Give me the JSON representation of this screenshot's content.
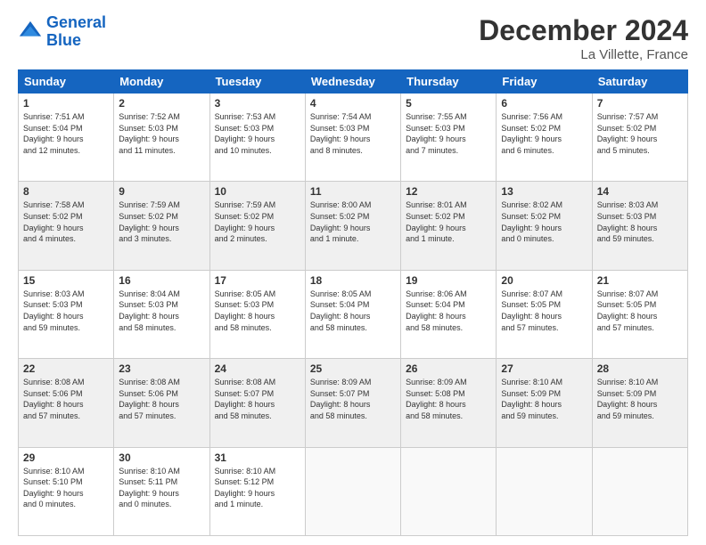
{
  "logo": {
    "line1": "General",
    "line2": "Blue"
  },
  "title": "December 2024",
  "location": "La Villette, France",
  "days_of_week": [
    "Sunday",
    "Monday",
    "Tuesday",
    "Wednesday",
    "Thursday",
    "Friday",
    "Saturday"
  ],
  "weeks": [
    [
      {
        "day": "1",
        "info": "Sunrise: 7:51 AM\nSunset: 5:04 PM\nDaylight: 9 hours\nand 12 minutes."
      },
      {
        "day": "2",
        "info": "Sunrise: 7:52 AM\nSunset: 5:03 PM\nDaylight: 9 hours\nand 11 minutes."
      },
      {
        "day": "3",
        "info": "Sunrise: 7:53 AM\nSunset: 5:03 PM\nDaylight: 9 hours\nand 10 minutes."
      },
      {
        "day": "4",
        "info": "Sunrise: 7:54 AM\nSunset: 5:03 PM\nDaylight: 9 hours\nand 8 minutes."
      },
      {
        "day": "5",
        "info": "Sunrise: 7:55 AM\nSunset: 5:03 PM\nDaylight: 9 hours\nand 7 minutes."
      },
      {
        "day": "6",
        "info": "Sunrise: 7:56 AM\nSunset: 5:02 PM\nDaylight: 9 hours\nand 6 minutes."
      },
      {
        "day": "7",
        "info": "Sunrise: 7:57 AM\nSunset: 5:02 PM\nDaylight: 9 hours\nand 5 minutes."
      }
    ],
    [
      {
        "day": "8",
        "info": "Sunrise: 7:58 AM\nSunset: 5:02 PM\nDaylight: 9 hours\nand 4 minutes."
      },
      {
        "day": "9",
        "info": "Sunrise: 7:59 AM\nSunset: 5:02 PM\nDaylight: 9 hours\nand 3 minutes."
      },
      {
        "day": "10",
        "info": "Sunrise: 7:59 AM\nSunset: 5:02 PM\nDaylight: 9 hours\nand 2 minutes."
      },
      {
        "day": "11",
        "info": "Sunrise: 8:00 AM\nSunset: 5:02 PM\nDaylight: 9 hours\nand 1 minute."
      },
      {
        "day": "12",
        "info": "Sunrise: 8:01 AM\nSunset: 5:02 PM\nDaylight: 9 hours\nand 1 minute."
      },
      {
        "day": "13",
        "info": "Sunrise: 8:02 AM\nSunset: 5:02 PM\nDaylight: 9 hours\nand 0 minutes."
      },
      {
        "day": "14",
        "info": "Sunrise: 8:03 AM\nSunset: 5:03 PM\nDaylight: 8 hours\nand 59 minutes."
      }
    ],
    [
      {
        "day": "15",
        "info": "Sunrise: 8:03 AM\nSunset: 5:03 PM\nDaylight: 8 hours\nand 59 minutes."
      },
      {
        "day": "16",
        "info": "Sunrise: 8:04 AM\nSunset: 5:03 PM\nDaylight: 8 hours\nand 58 minutes."
      },
      {
        "day": "17",
        "info": "Sunrise: 8:05 AM\nSunset: 5:03 PM\nDaylight: 8 hours\nand 58 minutes."
      },
      {
        "day": "18",
        "info": "Sunrise: 8:05 AM\nSunset: 5:04 PM\nDaylight: 8 hours\nand 58 minutes."
      },
      {
        "day": "19",
        "info": "Sunrise: 8:06 AM\nSunset: 5:04 PM\nDaylight: 8 hours\nand 58 minutes."
      },
      {
        "day": "20",
        "info": "Sunrise: 8:07 AM\nSunset: 5:05 PM\nDaylight: 8 hours\nand 57 minutes."
      },
      {
        "day": "21",
        "info": "Sunrise: 8:07 AM\nSunset: 5:05 PM\nDaylight: 8 hours\nand 57 minutes."
      }
    ],
    [
      {
        "day": "22",
        "info": "Sunrise: 8:08 AM\nSunset: 5:06 PM\nDaylight: 8 hours\nand 57 minutes."
      },
      {
        "day": "23",
        "info": "Sunrise: 8:08 AM\nSunset: 5:06 PM\nDaylight: 8 hours\nand 57 minutes."
      },
      {
        "day": "24",
        "info": "Sunrise: 8:08 AM\nSunset: 5:07 PM\nDaylight: 8 hours\nand 58 minutes."
      },
      {
        "day": "25",
        "info": "Sunrise: 8:09 AM\nSunset: 5:07 PM\nDaylight: 8 hours\nand 58 minutes."
      },
      {
        "day": "26",
        "info": "Sunrise: 8:09 AM\nSunset: 5:08 PM\nDaylight: 8 hours\nand 58 minutes."
      },
      {
        "day": "27",
        "info": "Sunrise: 8:10 AM\nSunset: 5:09 PM\nDaylight: 8 hours\nand 59 minutes."
      },
      {
        "day": "28",
        "info": "Sunrise: 8:10 AM\nSunset: 5:09 PM\nDaylight: 8 hours\nand 59 minutes."
      }
    ],
    [
      {
        "day": "29",
        "info": "Sunrise: 8:10 AM\nSunset: 5:10 PM\nDaylight: 9 hours\nand 0 minutes."
      },
      {
        "day": "30",
        "info": "Sunrise: 8:10 AM\nSunset: 5:11 PM\nDaylight: 9 hours\nand 0 minutes."
      },
      {
        "day": "31",
        "info": "Sunrise: 8:10 AM\nSunset: 5:12 PM\nDaylight: 9 hours\nand 1 minute."
      },
      {
        "day": "",
        "info": ""
      },
      {
        "day": "",
        "info": ""
      },
      {
        "day": "",
        "info": ""
      },
      {
        "day": "",
        "info": ""
      }
    ]
  ]
}
